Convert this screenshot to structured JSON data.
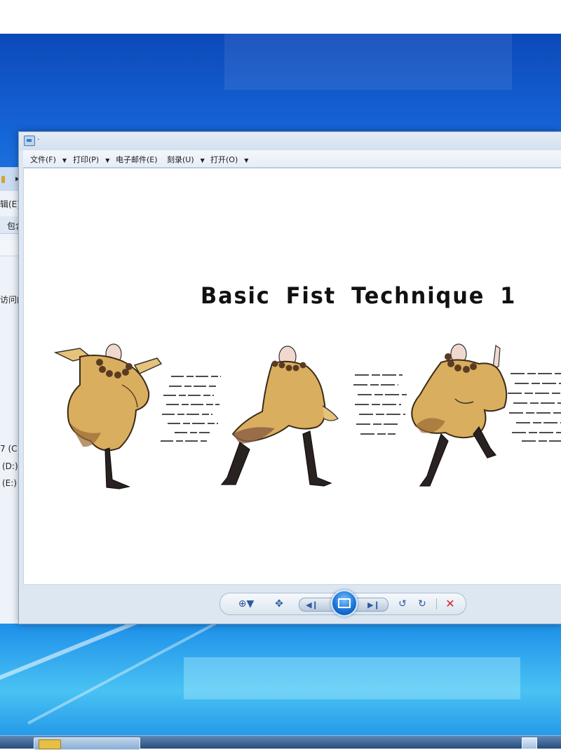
{
  "window": {
    "title_text": "·"
  },
  "menu": {
    "items": [
      {
        "label": "文件(F)"
      },
      {
        "label": "打印(P)"
      },
      {
        "label": "电子邮件(E)"
      },
      {
        "label": "刻录(U)"
      },
      {
        "label": "打开(O)"
      }
    ]
  },
  "image": {
    "title": "Basic  Fist  Technique  1"
  },
  "explorer": {
    "menu_edit": "辑(E)",
    "toolbar_include": "包含",
    "sidebar_recent": "访问的",
    "drive_c": "7 (C",
    "drive_d": "(D:)",
    "drive_e": "(E:)"
  },
  "controls": {
    "zoom_icon": "magnify-icon",
    "fit_icon": "fit-window-icon",
    "prev_icon": "previous-icon",
    "slideshow_icon": "slideshow-icon",
    "next_icon": "next-icon",
    "rotate_ccw_icon": "rotate-counterclockwise-icon",
    "rotate_cw_icon": "rotate-clockwise-icon",
    "delete_icon": "delete-icon",
    "delete_color": "#d0242b"
  },
  "colors": {
    "robe": "#d9ae5e",
    "robe_shadow": "#9a6a36",
    "beads": "#5a3b22",
    "boots": "#2a2220",
    "skin": "#f1d8cf"
  }
}
